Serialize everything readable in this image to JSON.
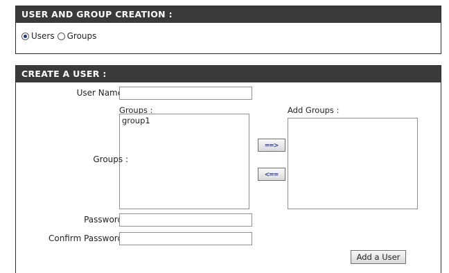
{
  "creation": {
    "title": "USER AND GROUP CREATION :",
    "options": [
      {
        "label": "Users",
        "checked": true
      },
      {
        "label": "Groups",
        "checked": false
      }
    ]
  },
  "create_user": {
    "title": "CREATE A USER :",
    "user_name_label": "User Name :",
    "user_name_value": "",
    "groups_label": "Groups :",
    "groups_list_caption": "Groups :",
    "groups_list_items": [
      "group1"
    ],
    "add_groups_caption": "Add Groups :",
    "add_groups_items": [],
    "move_right_label": "==>",
    "move_left_label": "<==",
    "password_label": "Password :",
    "password_value": "",
    "confirm_password_label": "Confirm Password :",
    "confirm_password_value": "",
    "add_user_label": "Add a User"
  }
}
